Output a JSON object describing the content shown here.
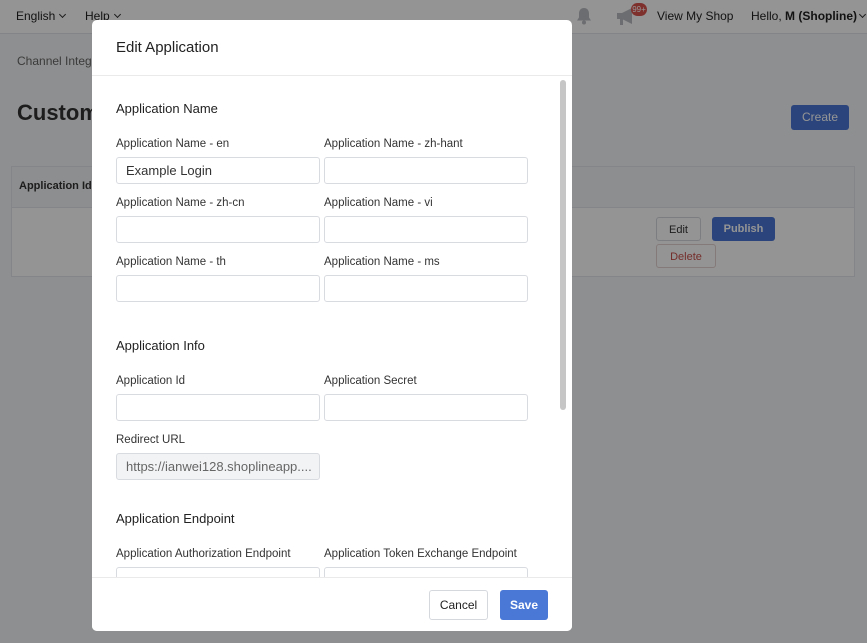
{
  "topbar": {
    "language": "English",
    "help": "Help",
    "notification_badge": "99+",
    "view_shop": "View My Shop",
    "greeting_prefix": "Hello,",
    "user_name": "M (Shopline)"
  },
  "page": {
    "breadcrumb": "Channel Integr",
    "title": "Custom",
    "create_button": "Create",
    "table_header_app_id": "Application Id",
    "row_edit": "Edit",
    "row_publish": "Publish",
    "row_delete": "Delete"
  },
  "modal": {
    "title": "Edit Application",
    "sections": {
      "name": "Application Name",
      "info": "Application Info",
      "endpoint": "Application Endpoint"
    },
    "fields": {
      "name_en": {
        "label": "Application Name - en",
        "value": "Example Login"
      },
      "name_zh_hant": {
        "label": "Application Name - zh-hant",
        "value": ""
      },
      "name_zh_cn": {
        "label": "Application Name - zh-cn",
        "value": ""
      },
      "name_vi": {
        "label": "Application Name - vi",
        "value": ""
      },
      "name_th": {
        "label": "Application Name - th",
        "value": ""
      },
      "name_ms": {
        "label": "Application Name - ms",
        "value": ""
      },
      "app_id": {
        "label": "Application Id",
        "value": ""
      },
      "app_secret": {
        "label": "Application Secret",
        "value": ""
      },
      "redirect_url": {
        "label": "Redirect URL",
        "value": "https://ianwei128.shoplineapp...."
      },
      "auth_endpoint": {
        "label": "Application Authorization Endpoint",
        "value": ""
      },
      "token_endpoint": {
        "label": "Application Token Exchange Endpoint",
        "value": ""
      }
    },
    "cancel_button": "Cancel",
    "save_button": "Save"
  },
  "colors": {
    "primary": "#4a78d6",
    "danger": "#c9504b",
    "badge": "#d9534f"
  }
}
